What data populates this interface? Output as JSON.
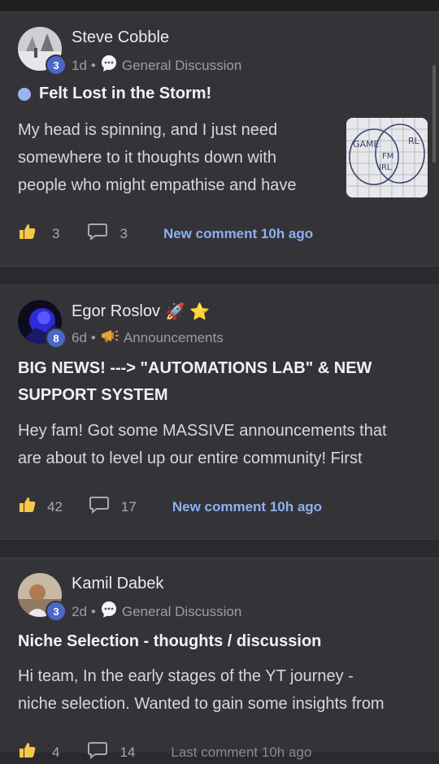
{
  "posts": [
    {
      "author": "Steve Cobble",
      "level": "3",
      "time": "1d",
      "category": "General Discussion",
      "category_icon": "speech-bubble-icon",
      "title": "Felt Lost in the Storm!",
      "excerpt_lines": [
        "My head is spinning, and I just need",
        "somewhere to it thoughts down with",
        "people who might empathise and have"
      ],
      "likes": "3",
      "comments": "3",
      "activity": "New comment 10h ago",
      "thumbnail_labels": [
        "GAME",
        "RL",
        "FM",
        "IRL"
      ]
    },
    {
      "author": "Egor Roslov",
      "author_emojis": "🚀 ⭐",
      "level": "8",
      "time": "6d",
      "category": "Announcements",
      "category_icon": "megaphone-icon",
      "title_lines": [
        "BIG NEWS! ---> \"AUTOMATIONS LAB\" & NEW",
        "SUPPORT SYSTEM"
      ],
      "excerpt_lines": [
        "Hey fam! Got some MASSIVE announcements that",
        "are about to level up our entire community! First"
      ],
      "likes": "42",
      "comments": "17",
      "activity": "New comment 10h ago"
    },
    {
      "author": "Kamil Dabek",
      "level": "3",
      "time": "2d",
      "category": "General Discussion",
      "category_icon": "speech-bubble-icon",
      "title": "Niche Selection - thoughts / discussion",
      "excerpt_lines": [
        "Hi team, In the early stages of the YT journey -",
        "niche selection. Wanted to gain some insights from"
      ],
      "likes": "4",
      "comments": "14",
      "activity": "Last comment 10h ago"
    }
  ],
  "colors": {
    "background": "#2a2a2e",
    "card": "#343438",
    "accent_link": "#8eb0f0",
    "level_badge": "#4b68c9",
    "unread_dot": "#9bb4f2"
  }
}
